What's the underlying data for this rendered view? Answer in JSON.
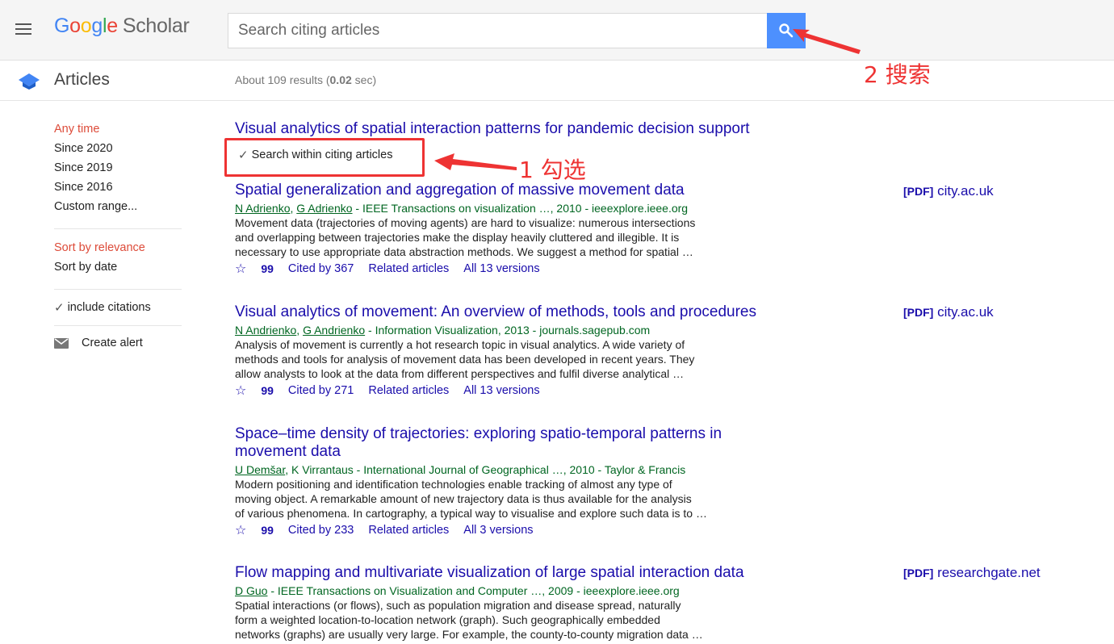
{
  "header": {
    "logo": {
      "google": [
        "G",
        "o",
        "o",
        "g",
        "l",
        "e"
      ],
      "scholar": "Scholar"
    },
    "search_placeholder": "Search citing articles",
    "search_button_icon": "search-icon"
  },
  "subheader": {
    "section_label": "Articles",
    "results_prefix": "About 109 results (",
    "results_time": "0.02",
    "results_suffix": " sec)"
  },
  "sidebar": {
    "time_filters": [
      "Any time",
      "Since 2020",
      "Since 2019",
      "Since 2016",
      "Custom range..."
    ],
    "sort_options": [
      "Sort by relevance",
      "Sort by date"
    ],
    "include_citations": "include citations",
    "create_alert": "Create alert"
  },
  "cited_article": {
    "title": "Visual analytics of spatial interaction patterns for pandemic decision support",
    "search_within_label": "Search within citing articles"
  },
  "results": [
    {
      "title": "Spatial generalization and aggregation of massive movement data",
      "author_links": [
        "N Adrienko",
        "G Adrienko"
      ],
      "author_sep": ", ",
      "meta": " - IEEE Transactions on visualization …, 2010 - ieeexplore.ieee.org",
      "snippet": [
        "Movement data (trajectories of moving agents) are hard to visualize: numerous intersections",
        "and overlapping between trajectories make the display heavily cluttered and illegible. It is",
        "necessary to use appropriate data abstraction methods. We suggest a method for spatial …"
      ],
      "cited_by": "Cited by 367",
      "related": "Related articles",
      "versions": "All 13 versions",
      "pdf_tag": "[PDF]",
      "pdf_source": "city.ac.uk"
    },
    {
      "title": "Visual analytics of movement: An overview of methods, tools and procedures",
      "author_links": [
        "N Andrienko",
        "G Andrienko"
      ],
      "author_sep": ", ",
      "meta": " - Information Visualization, 2013 - journals.sagepub.com",
      "snippet": [
        "Analysis of movement is currently a hot research topic in visual analytics. A wide variety of",
        "methods and tools for analysis of movement data has been developed in recent years. They",
        "allow analysts to look at the data from different perspectives and fulfil diverse analytical …"
      ],
      "cited_by": "Cited by 271",
      "related": "Related articles",
      "versions": "All 13 versions",
      "pdf_tag": "[PDF]",
      "pdf_source": "city.ac.uk"
    },
    {
      "title": "Space–time density of trajectories: exploring spatio-temporal patterns in movement data",
      "author_links": [
        "U Demšar"
      ],
      "author_sep": "",
      "meta": ", K Virrantaus - International Journal of Geographical …, 2010 - Taylor & Francis",
      "snippet": [
        "Modern positioning and identification technologies enable tracking of almost any type of",
        "moving object. A remarkable amount of new trajectory data is thus available for the analysis",
        "of various phenomena. In cartography, a typical way to visualise and explore such data is to …"
      ],
      "cited_by": "Cited by 233",
      "related": "Related articles",
      "versions": "All 3 versions"
    },
    {
      "title": "Flow mapping and multivariate visualization of large spatial interaction data",
      "author_links": [
        "D Guo"
      ],
      "author_sep": "",
      "meta": " - IEEE Transactions on Visualization and Computer …, 2009 - ieeexplore.ieee.org",
      "snippet": [
        "Spatial interactions (or flows), such as population migration and disease spread, naturally",
        "form a weighted location-to-location network (graph). Such geographically embedded",
        "networks (graphs) are usually very large. For example, the county-to-county migration data …"
      ],
      "pdf_tag": "[PDF]",
      "pdf_source": "researchgate.net"
    }
  ],
  "annotations": {
    "step1": "1 勾选",
    "step2": "2 搜索",
    "color": "#ee3333"
  },
  "colors": {
    "link": "#1a0dab",
    "author_green": "#006621",
    "active_red": "#dd4b39",
    "search_blue": "#4d90fe"
  }
}
